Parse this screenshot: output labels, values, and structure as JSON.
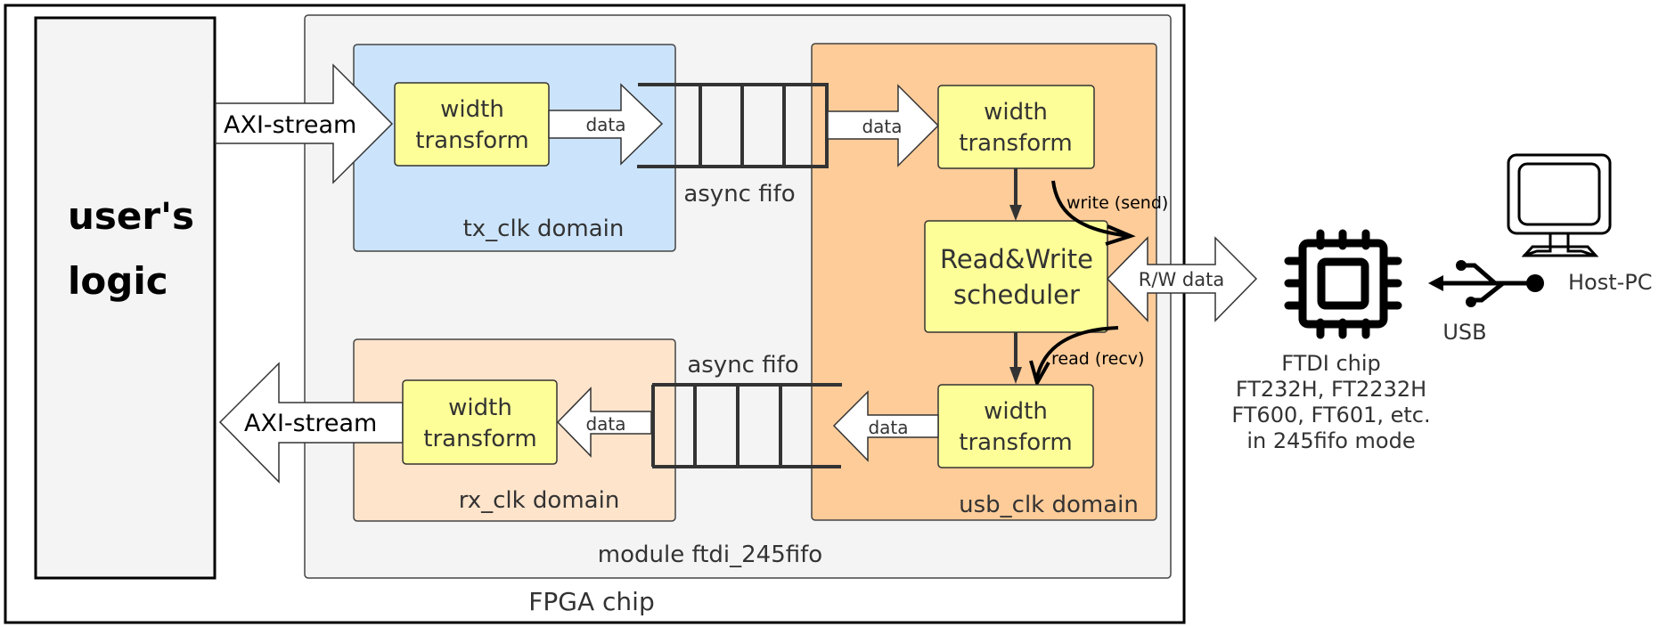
{
  "diagram": {
    "fpga_chip": {
      "label": "FPGA chip"
    },
    "user_logic": {
      "line1": "user's",
      "line2": "logic"
    },
    "module": {
      "label": "module  ftdi_245fifo"
    },
    "tx_domain": {
      "label": "tx_clk domain",
      "width_transform": {
        "line1": "width",
        "line2": "transform"
      },
      "data_arrow": "data"
    },
    "rx_domain": {
      "label": "rx_clk domain",
      "width_transform": {
        "line1": "width",
        "line2": "transform"
      },
      "data_arrow": "data"
    },
    "usb_domain": {
      "label": "usb_clk domain",
      "tx_width_transform": {
        "line1": "width",
        "line2": "transform"
      },
      "rx_width_transform": {
        "line1": "width",
        "line2": "transform"
      },
      "scheduler": {
        "line1": "Read&Write",
        "line2": "scheduler"
      },
      "tx_data_arrow": "data",
      "rx_data_arrow": "data",
      "write_label": "write (send)",
      "read_label": "read (recv)"
    },
    "tx_fifo": {
      "label": "async fifo"
    },
    "rx_fifo": {
      "label": "async fifo"
    },
    "axi_in": "AXI-stream",
    "axi_out": "AXI-stream",
    "rw_data": "R/W data",
    "ftdi": {
      "icon": "chip-icon",
      "lines": [
        "FTDI chip",
        "FT232H, FT2232H",
        "FT600, FT601, etc.",
        "in 245fifo mode"
      ]
    },
    "usb": {
      "icon": "usb-icon",
      "label": "USB"
    },
    "host": {
      "icon": "monitor-icon",
      "label": "Host-PC"
    },
    "colors": {
      "tx_domain": "#cce4fb",
      "rx_domain": "#fee4cb",
      "usb_domain": "#fecc99",
      "module": "#f4f4f4",
      "block": "#fefe99"
    }
  }
}
